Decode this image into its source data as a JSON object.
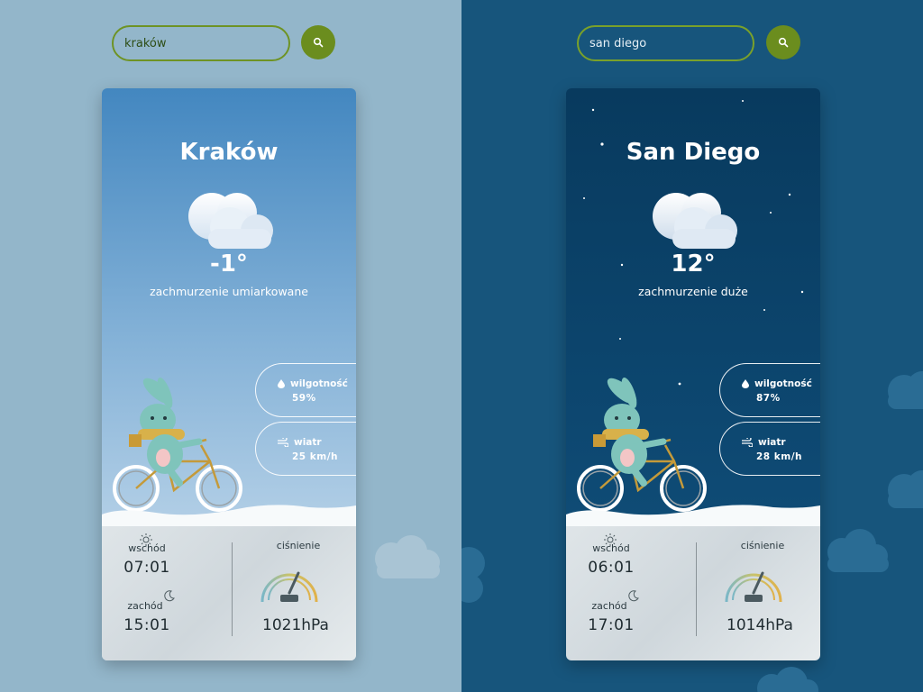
{
  "cards": [
    {
      "search_value": "kraków",
      "city": "Kraków",
      "temperature": "-1°",
      "description": "zachmurzenie umiarkowane",
      "humidity_label": "wilgotność",
      "humidity_value": "59%",
      "wind_label": "wiatr",
      "wind_value": "25 km/h",
      "sunrise_label": "wschód",
      "sunrise_time": "07:01",
      "sunset_label": "zachód",
      "sunset_time": "15:01",
      "pressure_label": "ciśnienie",
      "pressure_value": "1021hPa"
    },
    {
      "search_value": "san diego",
      "city": "San Diego",
      "temperature": "12°",
      "description": "zachmurzenie duże",
      "humidity_label": "wilgotność",
      "humidity_value": "87%",
      "wind_label": "wiatr",
      "wind_value": "28 km/h",
      "sunrise_label": "wschód",
      "sunrise_time": "06:01",
      "sunset_label": "zachód",
      "sunset_time": "17:01",
      "pressure_label": "ciśnienie",
      "pressure_value": "1014hPa"
    }
  ],
  "colors": {
    "left_background": "#93b6ca",
    "right_background": "#17557c",
    "search_accent": "#6b8d1e"
  },
  "icons": [
    "search-icon",
    "cloud-icon",
    "droplet-icon",
    "wind-icon",
    "sun-icon",
    "moon-icon",
    "pressure-gauge-icon"
  ]
}
